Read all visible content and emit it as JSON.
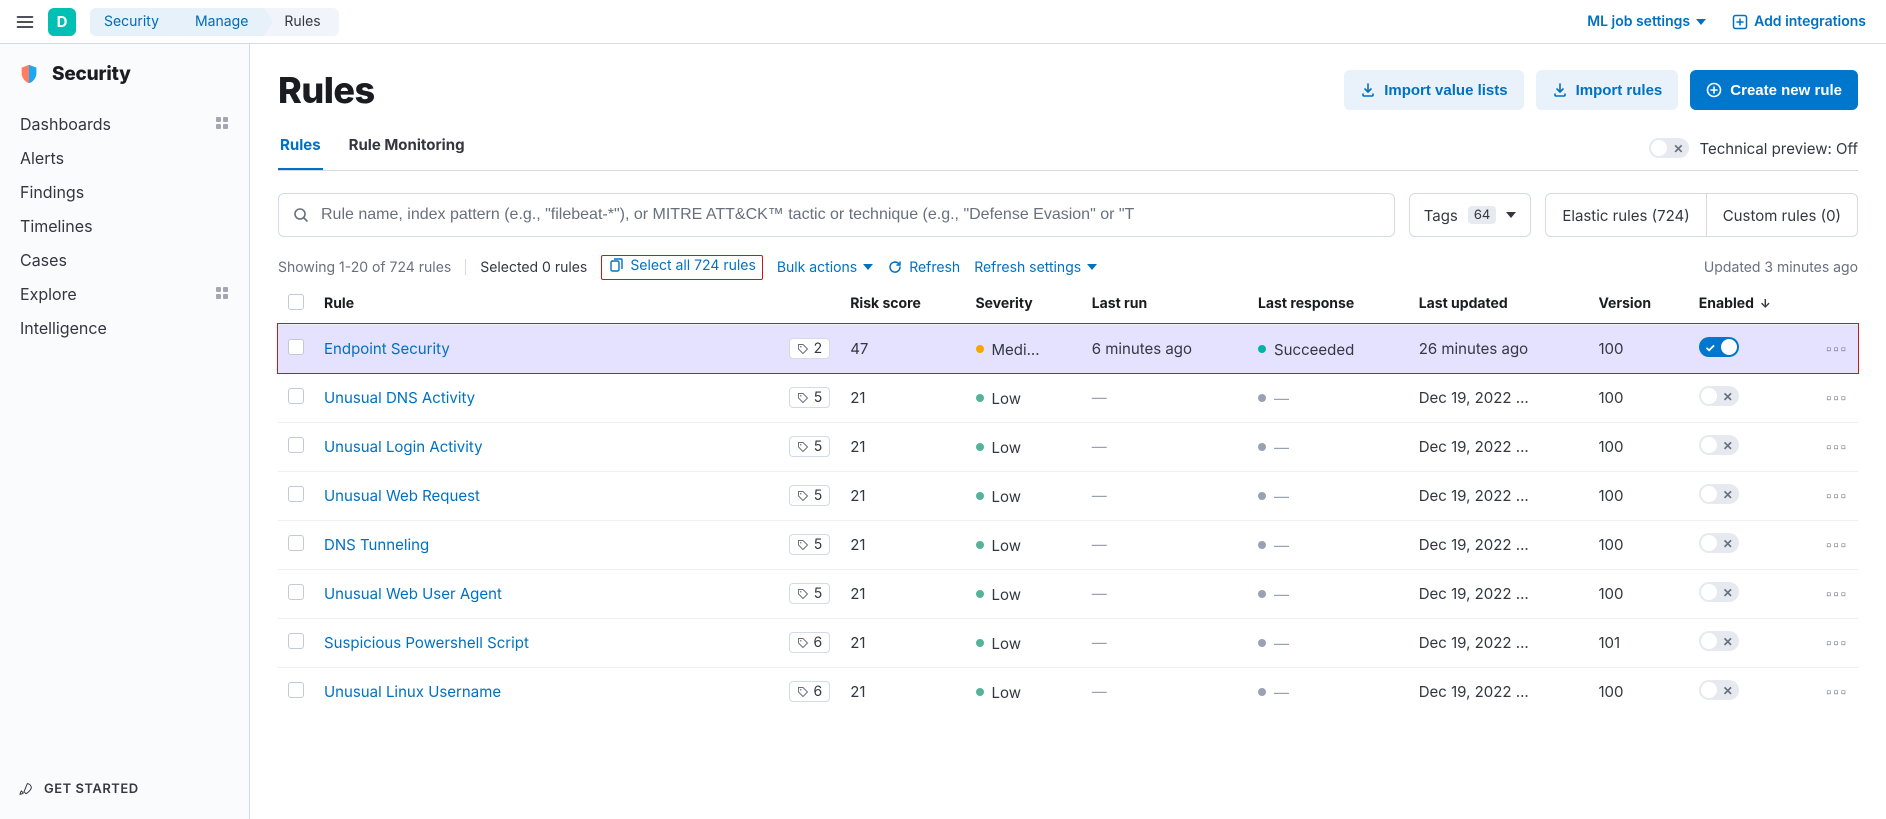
{
  "header": {
    "logo_letter": "D",
    "breadcrumbs": [
      "Security",
      "Manage",
      "Rules"
    ],
    "ml_job_settings": "ML job settings",
    "add_integrations": "Add integrations"
  },
  "sidebar": {
    "title": "Security",
    "items": [
      "Dashboards",
      "Alerts",
      "Findings",
      "Timelines",
      "Cases",
      "Explore",
      "Intelligence"
    ],
    "grid_on": [
      0,
      5
    ],
    "footer": "GET STARTED"
  },
  "page": {
    "title": "Rules",
    "import_value_lists": "Import value lists",
    "import_rules": "Import rules",
    "create_new_rule": "Create new rule"
  },
  "tabs": {
    "items": [
      "Rules",
      "Rule Monitoring"
    ],
    "active": 0,
    "preview_label": "Technical preview: Off"
  },
  "filters": {
    "search_placeholder": "Rule name, index pattern (e.g., \"filebeat-*\"), or MITRE ATT&CK™ tactic or technique (e.g., \"Defense Evasion\" or \"T",
    "tags_label": "Tags",
    "tags_count": "64",
    "elastic_rules": "Elastic rules (724)",
    "custom_rules": "Custom rules (0)"
  },
  "toolbar": {
    "showing": "Showing 1-20 of 724 rules",
    "selected": "Selected 0 rules",
    "select_all": "Select all 724 rules",
    "bulk_actions": "Bulk actions",
    "refresh": "Refresh",
    "refresh_settings": "Refresh settings",
    "updated": "Updated 3 minutes ago"
  },
  "columns": {
    "rule": "Rule",
    "risk": "Risk score",
    "severity": "Severity",
    "last_run": "Last run",
    "last_response": "Last response",
    "last_updated": "Last updated",
    "version": "Version",
    "enabled": "Enabled"
  },
  "rows": [
    {
      "name": "Endpoint Security",
      "tags": 2,
      "risk": 47,
      "severity": "Medi...",
      "sev_color": "orange",
      "last_run": "6 minutes ago",
      "last_response": "Succeeded",
      "resp_color": "teal",
      "last_updated": "26 minutes ago",
      "version": 100,
      "enabled": true,
      "highlight": true
    },
    {
      "name": "Unusual DNS Activity",
      "tags": 5,
      "risk": 21,
      "severity": "Low",
      "sev_color": "green",
      "last_run": "—",
      "last_response": "—",
      "resp_color": "gray",
      "last_updated": "Dec 19, 2022 ...",
      "version": 100,
      "enabled": false,
      "highlight": false
    },
    {
      "name": "Unusual Login Activity",
      "tags": 5,
      "risk": 21,
      "severity": "Low",
      "sev_color": "green",
      "last_run": "—",
      "last_response": "—",
      "resp_color": "gray",
      "last_updated": "Dec 19, 2022 ...",
      "version": 100,
      "enabled": false,
      "highlight": false
    },
    {
      "name": "Unusual Web Request",
      "tags": 5,
      "risk": 21,
      "severity": "Low",
      "sev_color": "green",
      "last_run": "—",
      "last_response": "—",
      "resp_color": "gray",
      "last_updated": "Dec 19, 2022 ...",
      "version": 100,
      "enabled": false,
      "highlight": false
    },
    {
      "name": "DNS Tunneling",
      "tags": 5,
      "risk": 21,
      "severity": "Low",
      "sev_color": "green",
      "last_run": "—",
      "last_response": "—",
      "resp_color": "gray",
      "last_updated": "Dec 19, 2022 ...",
      "version": 100,
      "enabled": false,
      "highlight": false
    },
    {
      "name": "Unusual Web User Agent",
      "tags": 5,
      "risk": 21,
      "severity": "Low",
      "sev_color": "green",
      "last_run": "—",
      "last_response": "—",
      "resp_color": "gray",
      "last_updated": "Dec 19, 2022 ...",
      "version": 100,
      "enabled": false,
      "highlight": false
    },
    {
      "name": "Suspicious Powershell Script",
      "tags": 6,
      "risk": 21,
      "severity": "Low",
      "sev_color": "green",
      "last_run": "—",
      "last_response": "—",
      "resp_color": "gray",
      "last_updated": "Dec 19, 2022 ...",
      "version": 101,
      "enabled": false,
      "highlight": false
    },
    {
      "name": "Unusual Linux Username",
      "tags": 6,
      "risk": 21,
      "severity": "Low",
      "sev_color": "green",
      "last_run": "—",
      "last_response": "—",
      "resp_color": "gray",
      "last_updated": "Dec 19, 2022 ...",
      "version": 100,
      "enabled": false,
      "highlight": false
    }
  ]
}
